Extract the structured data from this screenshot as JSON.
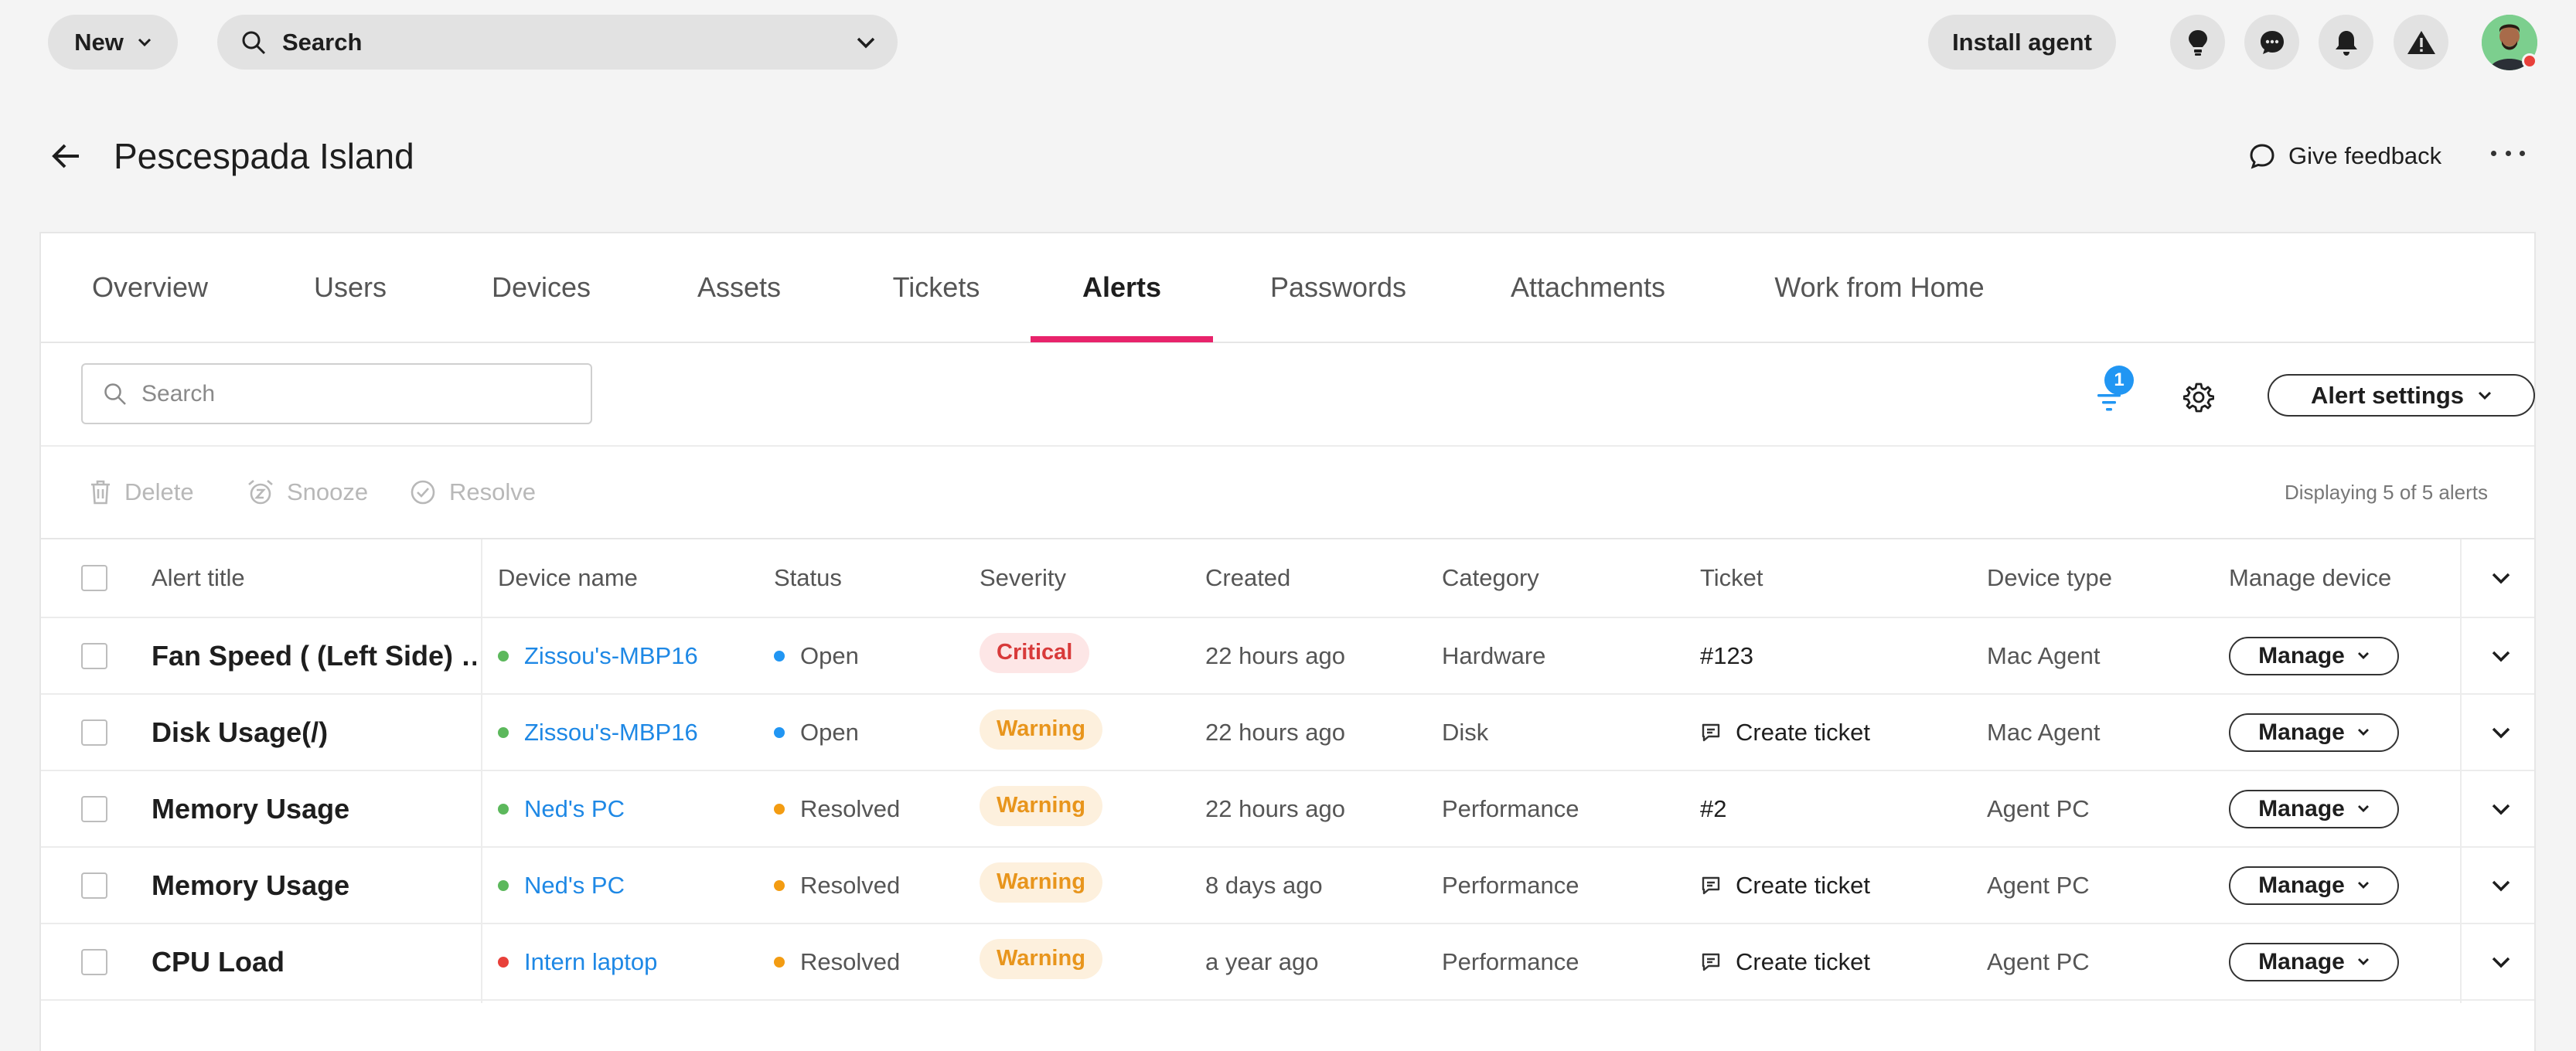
{
  "topbar": {
    "new_label": "New",
    "search_label": "Search",
    "install_label": "Install agent",
    "icons": [
      "lightbulb-icon",
      "chat-icon",
      "bell-icon",
      "warning-icon"
    ]
  },
  "page": {
    "title": "Pescespada Island",
    "feedback_label": "Give feedback"
  },
  "tabs": [
    {
      "label": "Overview",
      "active": false
    },
    {
      "label": "Users",
      "active": false
    },
    {
      "label": "Devices",
      "active": false
    },
    {
      "label": "Assets",
      "active": false
    },
    {
      "label": "Tickets",
      "active": false
    },
    {
      "label": "Alerts",
      "active": true
    },
    {
      "label": "Passwords",
      "active": false
    },
    {
      "label": "Attachments",
      "active": false
    },
    {
      "label": "Work from Home",
      "active": false
    }
  ],
  "toolbar": {
    "search_placeholder": "Search",
    "filter_count": "1",
    "alert_settings_label": "Alert settings"
  },
  "actions": {
    "delete_label": "Delete",
    "snooze_label": "Snooze",
    "resolve_label": "Resolve",
    "displaying": "Displaying 5 of 5 alerts"
  },
  "table": {
    "columns": {
      "alert_title": "Alert title",
      "device_name": "Device name",
      "status": "Status",
      "severity": "Severity",
      "created": "Created",
      "category": "Category",
      "ticket": "Ticket",
      "device_type": "Device type",
      "manage_device": "Manage device"
    },
    "rows": [
      {
        "title": "Fan Speed ( (Left Side) …",
        "device": "Zissou's-MBP16",
        "device_color": "#5cb85c",
        "status": "Open",
        "status_color": "#2196f3",
        "severity": "Critical",
        "severity_kind": "critical",
        "created": "22 hours ago",
        "category": "Hardware",
        "ticket": "#123",
        "ticket_kind": "number",
        "device_type": "Mac Agent",
        "manage": "Manage"
      },
      {
        "title": "Disk Usage(/)",
        "device": "Zissou's-MBP16",
        "device_color": "#5cb85c",
        "status": "Open",
        "status_color": "#2196f3",
        "severity": "Warning",
        "severity_kind": "warning",
        "created": "22 hours ago",
        "category": "Disk",
        "ticket": "Create ticket",
        "ticket_kind": "create",
        "device_type": "Mac Agent",
        "manage": "Manage"
      },
      {
        "title": "Memory Usage",
        "device": "Ned's PC",
        "device_color": "#5cb85c",
        "status": "Resolved",
        "status_color": "#f39c12",
        "severity": "Warning",
        "severity_kind": "warning",
        "created": "22 hours ago",
        "category": "Performance",
        "ticket": "#2",
        "ticket_kind": "number",
        "device_type": "Agent PC",
        "manage": "Manage"
      },
      {
        "title": "Memory Usage",
        "device": "Ned's PC",
        "device_color": "#5cb85c",
        "status": "Resolved",
        "status_color": "#f39c12",
        "severity": "Warning",
        "severity_kind": "warning",
        "created": "8 days ago",
        "category": "Performance",
        "ticket": "Create ticket",
        "ticket_kind": "create",
        "device_type": "Agent PC",
        "manage": "Manage"
      },
      {
        "title": "CPU Load",
        "device": "Intern laptop",
        "device_color": "#e8403a",
        "status": "Resolved",
        "status_color": "#f39c12",
        "severity": "Warning",
        "severity_kind": "warning",
        "created": "a year ago",
        "category": "Performance",
        "ticket": "Create ticket",
        "ticket_kind": "create",
        "device_type": "Agent PC",
        "manage": "Manage"
      }
    ]
  },
  "colors": {
    "accent_tab": "#e8236b",
    "link": "#1e88e5",
    "badge": "#2196f3",
    "critical_bg": "#fde6e6",
    "critical_text": "#d83a3a",
    "warning_bg": "#fdf0dd",
    "warning_text": "#e8951c"
  }
}
